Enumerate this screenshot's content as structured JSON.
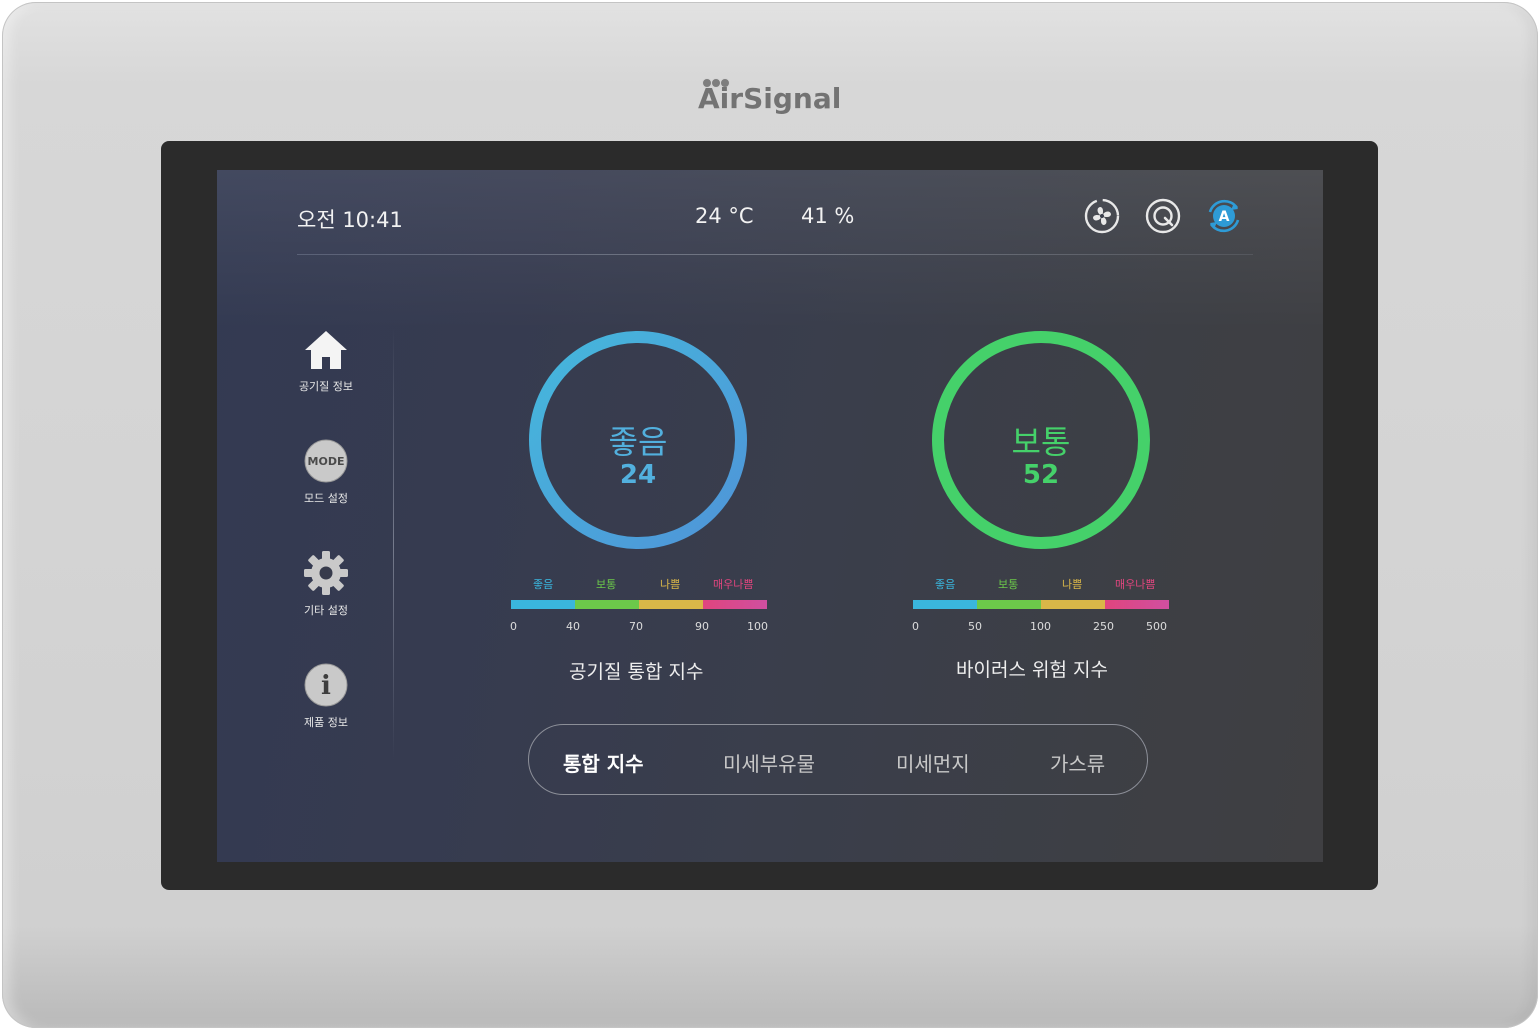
{
  "brand": {
    "name": "AirSignal"
  },
  "status_bar": {
    "time": "오전  10:41",
    "temperature": "24 °C",
    "humidity": "41 %",
    "icons": [
      "fan-icon",
      "filter-icon",
      "auto-mode-icon"
    ],
    "accent_color": "#2e9bd6"
  },
  "sidebar": {
    "items": [
      {
        "label": "공기질 정보",
        "icon": "home-icon"
      },
      {
        "label": "모드 설정",
        "icon": "mode-icon",
        "badge": "MODE"
      },
      {
        "label": "기타 설정",
        "icon": "gear-icon"
      },
      {
        "label": "제품 정보",
        "icon": "info-icon",
        "badge": "i"
      }
    ]
  },
  "gauges": [
    {
      "status": "좋음",
      "value": "24",
      "color": "#4aa7dc",
      "caption": "공기질 통합 지수",
      "scale_names": [
        "좋음",
        "보통",
        "나쁨",
        "매우나쁨"
      ],
      "scale_ticks": [
        "0",
        "40",
        "70",
        "90",
        "100"
      ]
    },
    {
      "status": "보통",
      "value": "52",
      "color": "#45d16a",
      "caption": "바이러스 위험 지수",
      "scale_names": [
        "좋음",
        "보통",
        "나쁨",
        "매우나쁨"
      ],
      "scale_ticks": [
        "0",
        "50",
        "100",
        "250",
        "500"
      ]
    }
  ],
  "scale_colors": {
    "good": "#3ab6dd",
    "normal": "#6cc94a",
    "bad": "#d9b748",
    "very_bad": "#e0457e"
  },
  "tabs": [
    {
      "label": "통합 지수",
      "active": true
    },
    {
      "label": "미세부유물",
      "active": false
    },
    {
      "label": "미세먼지",
      "active": false
    },
    {
      "label": "가스류",
      "active": false
    }
  ]
}
